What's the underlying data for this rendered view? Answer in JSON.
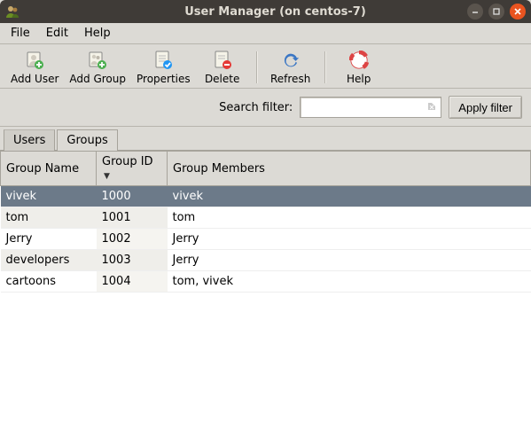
{
  "window": {
    "title": "User Manager (on centos-7)"
  },
  "menu": {
    "file": "File",
    "edit": "Edit",
    "help": "Help"
  },
  "toolbar": {
    "add_user": "Add User",
    "add_group": "Add Group",
    "properties": "Properties",
    "delete": "Delete",
    "refresh": "Refresh",
    "help": "Help"
  },
  "search": {
    "label": "Search filter:",
    "value": "",
    "placeholder": "",
    "apply": "Apply filter"
  },
  "tabs": {
    "users": "Users",
    "groups": "Groups",
    "active": "groups"
  },
  "table": {
    "columns": {
      "name": "Group Name",
      "id": "Group ID",
      "members": "Group Members"
    },
    "sort_column": "id",
    "sort_dir": "asc",
    "rows": [
      {
        "name": "vivek",
        "id": "1000",
        "members": "vivek",
        "selected": true
      },
      {
        "name": "tom",
        "id": "1001",
        "members": "tom",
        "selected": false
      },
      {
        "name": "Jerry",
        "id": "1002",
        "members": "Jerry",
        "selected": false
      },
      {
        "name": "developers",
        "id": "1003",
        "members": "Jerry",
        "selected": false
      },
      {
        "name": "cartoons",
        "id": "1004",
        "members": "tom, vivek",
        "selected": false
      }
    ]
  },
  "colors": {
    "selection": "#6c7a89",
    "accent_close": "#e95420"
  }
}
